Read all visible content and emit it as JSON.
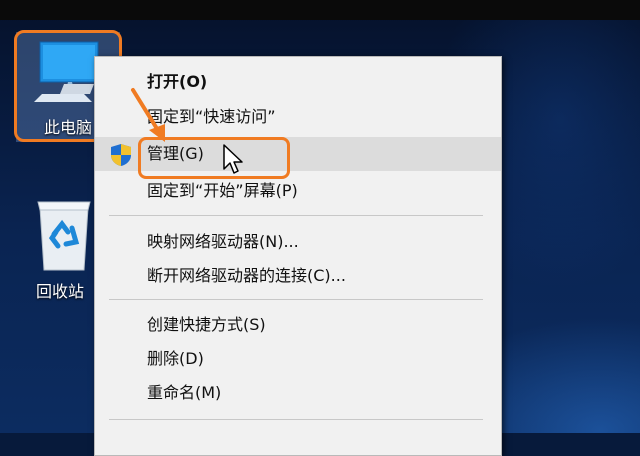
{
  "desktop": {
    "icons": [
      {
        "label": "此电脑",
        "icon": "this-pc-icon"
      },
      {
        "label": "回收站",
        "icon": "recycle-bin-icon"
      }
    ]
  },
  "context_menu": {
    "items": [
      {
        "label": "打开(O)",
        "bold": true
      },
      {
        "label": "固定到“快速访问”"
      },
      {
        "label": "管理(G)",
        "icon": "uac-shield-icon",
        "hover": true
      },
      {
        "label": "固定到“开始”屏幕(P)"
      },
      {
        "label": "映射网络驱动器(N)..."
      },
      {
        "label": "断开网络驱动器的连接(C)..."
      },
      {
        "label": "创建快捷方式(S)"
      },
      {
        "label": "删除(D)"
      },
      {
        "label": "重命名(M)"
      }
    ]
  },
  "annotation": {
    "color": "#f07b22"
  }
}
